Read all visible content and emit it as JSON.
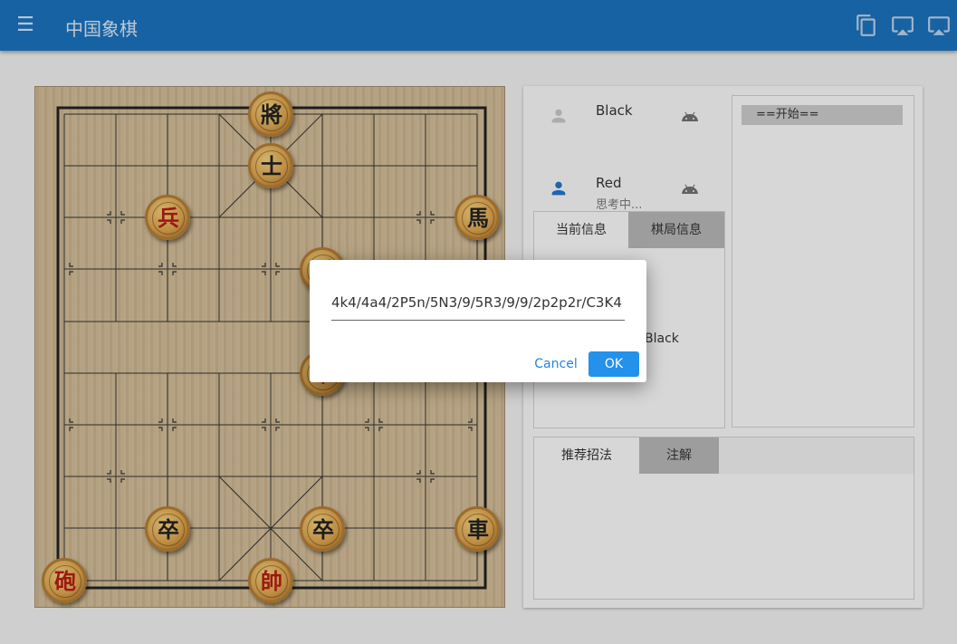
{
  "appbar": {
    "title": "中国象棋",
    "menu_icon": "menu-icon",
    "actions": [
      {
        "icon": "copy-icon"
      },
      {
        "icon": "cast-icon"
      },
      {
        "icon": "airplay-icon"
      }
    ],
    "color": "#1b70ba"
  },
  "board": {
    "pieces": [
      {
        "char": "將",
        "side": "black",
        "col": 4,
        "row": 0
      },
      {
        "char": "士",
        "side": "black",
        "col": 4,
        "row": 1
      },
      {
        "char": "兵",
        "side": "red",
        "col": 2,
        "row": 2
      },
      {
        "char": "馬",
        "side": "black",
        "col": 8,
        "row": 2
      },
      {
        "char": "兵",
        "side": "red",
        "col": 5,
        "row": 3
      },
      {
        "char": "車",
        "side": "red",
        "col": 5,
        "row": 5
      },
      {
        "char": "卒",
        "side": "black",
        "col": 2,
        "row": 8
      },
      {
        "char": "卒",
        "side": "black",
        "col": 5,
        "row": 8
      },
      {
        "char": "車",
        "side": "black",
        "col": 8,
        "row": 8
      },
      {
        "char": "砲",
        "side": "red",
        "col": 0,
        "row": 9
      },
      {
        "char": "帥",
        "side": "red",
        "col": 4,
        "row": 9
      }
    ]
  },
  "players": [
    {
      "name": "Black",
      "status": "",
      "icon": "person-icon",
      "bot_icon": "android-icon",
      "active": false
    },
    {
      "name": "Red",
      "status": "思考中...",
      "icon": "person-icon",
      "bot_icon": "android-icon",
      "active": true
    }
  ],
  "info_tabs": {
    "tabs": [
      "当前信息",
      "棋局信息"
    ],
    "active": 0,
    "partial_text": "Black"
  },
  "move_list": {
    "items": [
      "==开始=="
    ]
  },
  "bottom_tabs": {
    "tabs": [
      "推荐招法",
      "注解"
    ],
    "active": 0
  },
  "dialog": {
    "value": "4k4/4a4/2P5n/5N3/9/5R3/9/9/2p2p2r/C3K4",
    "cancel_label": "Cancel",
    "ok_label": "OK"
  }
}
